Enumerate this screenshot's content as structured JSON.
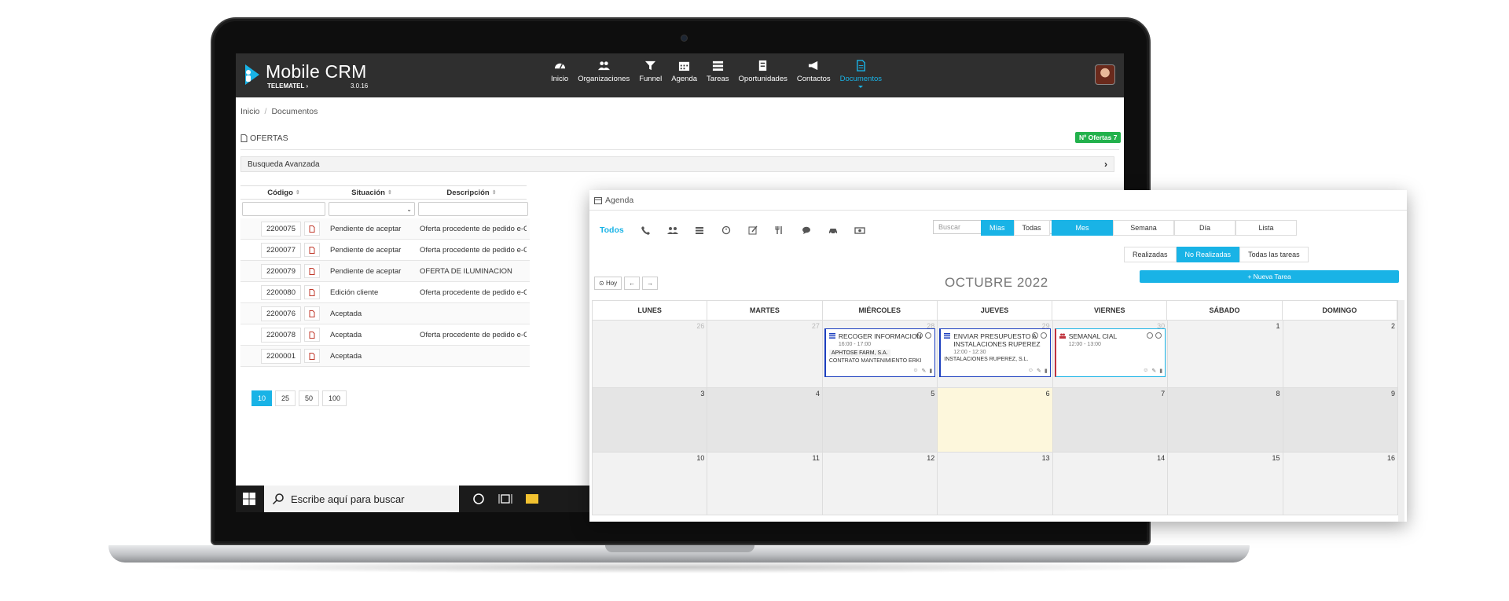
{
  "app": {
    "logo_title": "Mobile CRM",
    "logo_sub": "TELEMATEL",
    "version": "3.0.16",
    "brand_color": "#19b3e6",
    "nav": [
      {
        "label": "Inicio",
        "icon": "dashboard-icon"
      },
      {
        "label": "Organizaciones",
        "icon": "users-icon"
      },
      {
        "label": "Funnel",
        "icon": "funnel-icon"
      },
      {
        "label": "Agenda",
        "icon": "calendar-icon"
      },
      {
        "label": "Tareas",
        "icon": "tasks-icon"
      },
      {
        "label": "Oportunidades",
        "icon": "clipboard-icon"
      },
      {
        "label": "Contactos",
        "icon": "megaphone-icon"
      },
      {
        "label": "Documentos",
        "icon": "document-icon",
        "active": true
      }
    ]
  },
  "breadcrumb": {
    "home": "Inicio",
    "current": "Documentos"
  },
  "section": {
    "title": "OFERTAS",
    "badge": "Nº Ofertas 7"
  },
  "advanced_search": "Busqueda Avanzada",
  "table": {
    "headers": [
      "Código",
      "Situación",
      "Descripción"
    ],
    "rows": [
      {
        "code": "2200075",
        "status": "Pendiente de aceptar",
        "desc": "Oferta procedente de pedido e-Commerce"
      },
      {
        "code": "2200077",
        "status": "Pendiente de aceptar",
        "desc": "Oferta procedente de pedido e-Commerce"
      },
      {
        "code": "2200079",
        "status": "Pendiente de aceptar",
        "desc": "OFERTA DE ILUMINACION"
      },
      {
        "code": "2200080",
        "status": "Edición cliente",
        "desc": "Oferta procedente de pedido e-Commerce"
      },
      {
        "code": "2200076",
        "status": "Aceptada",
        "desc": ""
      },
      {
        "code": "2200078",
        "status": "Aceptada",
        "desc": "Oferta procedente de pedido e-Commerce"
      },
      {
        "code": "2200001",
        "status": "Aceptada",
        "desc": ""
      }
    ],
    "page_sizes": [
      "10",
      "25",
      "50",
      "100"
    ],
    "page_size_selected": "10"
  },
  "taskbar": {
    "search_placeholder": "Escribe aquí para buscar"
  },
  "agenda": {
    "title": "Agenda",
    "filter_all": "Todos",
    "search_placeholder": "Buscar",
    "owner_toggle": [
      "Mías",
      "Todas"
    ],
    "owner_selected": "Mías",
    "views": [
      "Mes",
      "Semana",
      "Día",
      "Lista"
    ],
    "view_selected": "Mes",
    "status_toggle": [
      "Realizadas",
      "No Realizadas",
      "Todas las tareas"
    ],
    "status_selected": "No Realizadas",
    "today_label": "Hoy",
    "prev_label": "←",
    "next_label": "→",
    "month_title": "OCTUBRE 2022",
    "new_task": "+ Nueva Tarea",
    "weekdays": [
      "LUNES",
      "MARTES",
      "MIÉRCOLES",
      "JUEVES",
      "VIERNES",
      "SÁBADO",
      "DOMINGO"
    ],
    "weeks": [
      [
        "26",
        "27",
        "28",
        "29",
        "30",
        "1",
        "2"
      ],
      [
        "3",
        "4",
        "5",
        "6",
        "7",
        "8",
        "9"
      ],
      [
        "10",
        "11",
        "12",
        "13",
        "14",
        "15",
        "16"
      ]
    ],
    "events": [
      {
        "title": "RECOGER INFORMACION",
        "time": "16:00 - 17:00",
        "company": "APHTOSE FARM, S.A.",
        "extra": "CONTRATO MANTENIMIENTO ERKI"
      },
      {
        "title": "ENVIAR PRESUPUESTO A INSTALACIONES RUPEREZ",
        "time": "12:00 - 12:30",
        "company": "INSTALACIONES RUPEREZ, S.L."
      },
      {
        "title": "SEMANAL CIAL",
        "time": "12:00 - 13:00"
      }
    ]
  }
}
